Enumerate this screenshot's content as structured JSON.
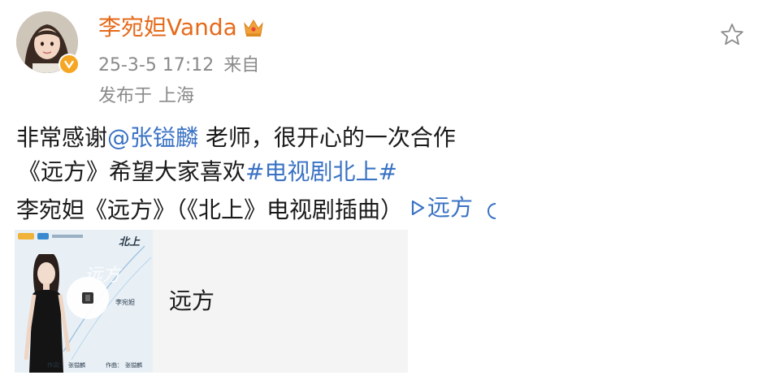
{
  "user": {
    "name": "李宛妲Vanda",
    "timestamp": "25-3-5 17:12",
    "source": "来自",
    "location_prefix": "发布于",
    "location": "上海"
  },
  "post": {
    "line1_a": "非常感谢",
    "mention": "@张镒麟",
    "line1_b": " 老师，很开心的一次合作",
    "line2_a": "《远方》希望大家喜欢",
    "hashtag": "#电视剧北上#",
    "line3_a": "李宛妲《远方》（《北上》电视剧插曲）",
    "play_link": "远方"
  },
  "music_card": {
    "title": "远方",
    "cover_title": "北上",
    "cover_song": "远方",
    "cover_singer": "李宛妲",
    "cover_lyricist_label": "作词：",
    "cover_lyricist": "张镒麟",
    "cover_composer_label": "作曲：",
    "cover_composer": "张镒麟"
  },
  "icons": {
    "verified": "verified-badge-icon",
    "crown": "crown-icon",
    "star": "star-outline-icon",
    "play": "play-icon",
    "extra": "moon-icon"
  },
  "colors": {
    "username": "#e56a1a",
    "link": "#3a72c4",
    "meta": "#8a8a8a",
    "verified": "#f5a623"
  }
}
